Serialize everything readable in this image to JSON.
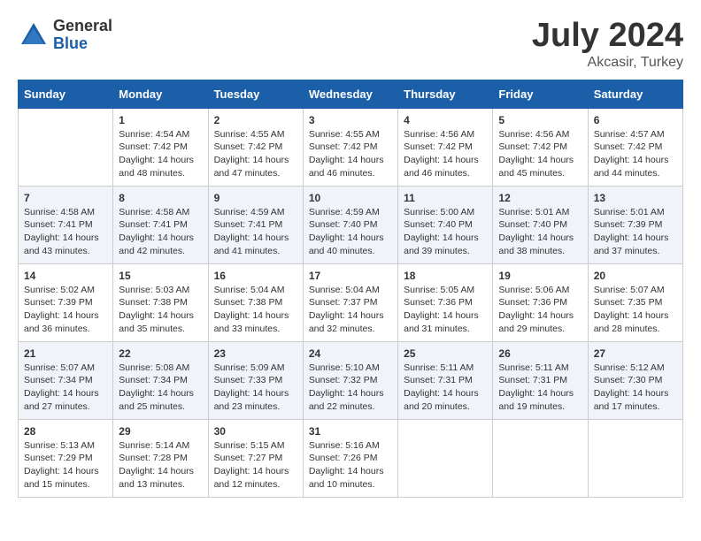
{
  "header": {
    "logo_general": "General",
    "logo_blue": "Blue",
    "month_title": "July 2024",
    "location": "Akcasir, Turkey"
  },
  "weekdays": [
    "Sunday",
    "Monday",
    "Tuesday",
    "Wednesday",
    "Thursday",
    "Friday",
    "Saturday"
  ],
  "weeks": [
    [
      {
        "day": "",
        "sunrise": "",
        "sunset": "",
        "daylight": ""
      },
      {
        "day": "1",
        "sunrise": "Sunrise: 4:54 AM",
        "sunset": "Sunset: 7:42 PM",
        "daylight": "Daylight: 14 hours and 48 minutes."
      },
      {
        "day": "2",
        "sunrise": "Sunrise: 4:55 AM",
        "sunset": "Sunset: 7:42 PM",
        "daylight": "Daylight: 14 hours and 47 minutes."
      },
      {
        "day": "3",
        "sunrise": "Sunrise: 4:55 AM",
        "sunset": "Sunset: 7:42 PM",
        "daylight": "Daylight: 14 hours and 46 minutes."
      },
      {
        "day": "4",
        "sunrise": "Sunrise: 4:56 AM",
        "sunset": "Sunset: 7:42 PM",
        "daylight": "Daylight: 14 hours and 46 minutes."
      },
      {
        "day": "5",
        "sunrise": "Sunrise: 4:56 AM",
        "sunset": "Sunset: 7:42 PM",
        "daylight": "Daylight: 14 hours and 45 minutes."
      },
      {
        "day": "6",
        "sunrise": "Sunrise: 4:57 AM",
        "sunset": "Sunset: 7:42 PM",
        "daylight": "Daylight: 14 hours and 44 minutes."
      }
    ],
    [
      {
        "day": "7",
        "sunrise": "Sunrise: 4:58 AM",
        "sunset": "Sunset: 7:41 PM",
        "daylight": "Daylight: 14 hours and 43 minutes."
      },
      {
        "day": "8",
        "sunrise": "Sunrise: 4:58 AM",
        "sunset": "Sunset: 7:41 PM",
        "daylight": "Daylight: 14 hours and 42 minutes."
      },
      {
        "day": "9",
        "sunrise": "Sunrise: 4:59 AM",
        "sunset": "Sunset: 7:41 PM",
        "daylight": "Daylight: 14 hours and 41 minutes."
      },
      {
        "day": "10",
        "sunrise": "Sunrise: 4:59 AM",
        "sunset": "Sunset: 7:40 PM",
        "daylight": "Daylight: 14 hours and 40 minutes."
      },
      {
        "day": "11",
        "sunrise": "Sunrise: 5:00 AM",
        "sunset": "Sunset: 7:40 PM",
        "daylight": "Daylight: 14 hours and 39 minutes."
      },
      {
        "day": "12",
        "sunrise": "Sunrise: 5:01 AM",
        "sunset": "Sunset: 7:40 PM",
        "daylight": "Daylight: 14 hours and 38 minutes."
      },
      {
        "day": "13",
        "sunrise": "Sunrise: 5:01 AM",
        "sunset": "Sunset: 7:39 PM",
        "daylight": "Daylight: 14 hours and 37 minutes."
      }
    ],
    [
      {
        "day": "14",
        "sunrise": "Sunrise: 5:02 AM",
        "sunset": "Sunset: 7:39 PM",
        "daylight": "Daylight: 14 hours and 36 minutes."
      },
      {
        "day": "15",
        "sunrise": "Sunrise: 5:03 AM",
        "sunset": "Sunset: 7:38 PM",
        "daylight": "Daylight: 14 hours and 35 minutes."
      },
      {
        "day": "16",
        "sunrise": "Sunrise: 5:04 AM",
        "sunset": "Sunset: 7:38 PM",
        "daylight": "Daylight: 14 hours and 33 minutes."
      },
      {
        "day": "17",
        "sunrise": "Sunrise: 5:04 AM",
        "sunset": "Sunset: 7:37 PM",
        "daylight": "Daylight: 14 hours and 32 minutes."
      },
      {
        "day": "18",
        "sunrise": "Sunrise: 5:05 AM",
        "sunset": "Sunset: 7:36 PM",
        "daylight": "Daylight: 14 hours and 31 minutes."
      },
      {
        "day": "19",
        "sunrise": "Sunrise: 5:06 AM",
        "sunset": "Sunset: 7:36 PM",
        "daylight": "Daylight: 14 hours and 29 minutes."
      },
      {
        "day": "20",
        "sunrise": "Sunrise: 5:07 AM",
        "sunset": "Sunset: 7:35 PM",
        "daylight": "Daylight: 14 hours and 28 minutes."
      }
    ],
    [
      {
        "day": "21",
        "sunrise": "Sunrise: 5:07 AM",
        "sunset": "Sunset: 7:34 PM",
        "daylight": "Daylight: 14 hours and 27 minutes."
      },
      {
        "day": "22",
        "sunrise": "Sunrise: 5:08 AM",
        "sunset": "Sunset: 7:34 PM",
        "daylight": "Daylight: 14 hours and 25 minutes."
      },
      {
        "day": "23",
        "sunrise": "Sunrise: 5:09 AM",
        "sunset": "Sunset: 7:33 PM",
        "daylight": "Daylight: 14 hours and 23 minutes."
      },
      {
        "day": "24",
        "sunrise": "Sunrise: 5:10 AM",
        "sunset": "Sunset: 7:32 PM",
        "daylight": "Daylight: 14 hours and 22 minutes."
      },
      {
        "day": "25",
        "sunrise": "Sunrise: 5:11 AM",
        "sunset": "Sunset: 7:31 PM",
        "daylight": "Daylight: 14 hours and 20 minutes."
      },
      {
        "day": "26",
        "sunrise": "Sunrise: 5:11 AM",
        "sunset": "Sunset: 7:31 PM",
        "daylight": "Daylight: 14 hours and 19 minutes."
      },
      {
        "day": "27",
        "sunrise": "Sunrise: 5:12 AM",
        "sunset": "Sunset: 7:30 PM",
        "daylight": "Daylight: 14 hours and 17 minutes."
      }
    ],
    [
      {
        "day": "28",
        "sunrise": "Sunrise: 5:13 AM",
        "sunset": "Sunset: 7:29 PM",
        "daylight": "Daylight: 14 hours and 15 minutes."
      },
      {
        "day": "29",
        "sunrise": "Sunrise: 5:14 AM",
        "sunset": "Sunset: 7:28 PM",
        "daylight": "Daylight: 14 hours and 13 minutes."
      },
      {
        "day": "30",
        "sunrise": "Sunrise: 5:15 AM",
        "sunset": "Sunset: 7:27 PM",
        "daylight": "Daylight: 14 hours and 12 minutes."
      },
      {
        "day": "31",
        "sunrise": "Sunrise: 5:16 AM",
        "sunset": "Sunset: 7:26 PM",
        "daylight": "Daylight: 14 hours and 10 minutes."
      },
      {
        "day": "",
        "sunrise": "",
        "sunset": "",
        "daylight": ""
      },
      {
        "day": "",
        "sunrise": "",
        "sunset": "",
        "daylight": ""
      },
      {
        "day": "",
        "sunrise": "",
        "sunset": "",
        "daylight": ""
      }
    ]
  ]
}
